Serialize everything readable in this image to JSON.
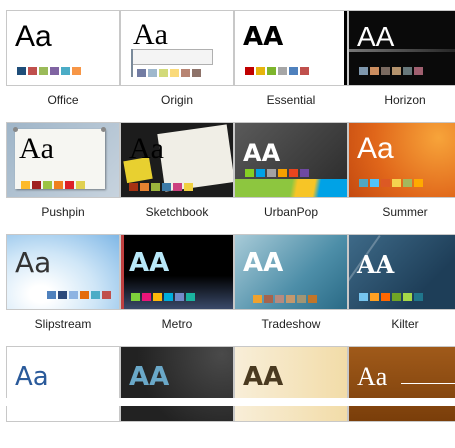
{
  "themes": [
    {
      "name": "Office",
      "aa": "Aa",
      "swatches": [
        "#1f4e79",
        "#c0504d",
        "#9bbb59",
        "#8064a2",
        "#4bacc6",
        "#f79646"
      ]
    },
    {
      "name": "Origin",
      "aa": "Aa",
      "swatches": [
        "#727ca3",
        "#9fb8cd",
        "#d2da7a",
        "#fada7a",
        "#b88472",
        "#8e736a"
      ]
    },
    {
      "name": "Essential",
      "aa": "AA",
      "swatches": [
        "#c00000",
        "#e6b40c",
        "#7db52c",
        "#a6a6a6",
        "#4f81bd",
        "#c0504d"
      ]
    },
    {
      "name": "Horizon",
      "aa": "AA",
      "swatches": [
        "#7e97ad",
        "#cc8e60",
        "#7a6a60",
        "#b4936d",
        "#67787b",
        "#a06070"
      ]
    },
    {
      "name": "Pushpin",
      "aa": "Aa",
      "swatches": [
        "#fdba2c",
        "#a02020",
        "#9cc442",
        "#f08020",
        "#dc2028",
        "#e0d050"
      ]
    },
    {
      "name": "Sketchbook",
      "aa": "Aa",
      "swatches": [
        "#a63212",
        "#e68230",
        "#9bb43c",
        "#3c7aa8",
        "#cc4080",
        "#f0d040"
      ]
    },
    {
      "name": "UrbanPop",
      "aa": "AA",
      "swatches": [
        "#86ce24",
        "#00a2e6",
        "#a3a3a3",
        "#f6a000",
        "#e8451e",
        "#6e49a2"
      ]
    },
    {
      "name": "Summer",
      "aa": "Aa",
      "swatches": [
        "#51a6c2",
        "#51c3f9",
        "#dc5924",
        "#f4d44f",
        "#a3b85d",
        "#ffaa00"
      ]
    },
    {
      "name": "Slipstream",
      "aa": "Aa",
      "swatches": [
        "#4f81bd",
        "#2c4a7c",
        "#8db3e2",
        "#e46c0a",
        "#4bacc6",
        "#c0504d"
      ]
    },
    {
      "name": "Metro",
      "aa": "AA",
      "swatches": [
        "#7fd13b",
        "#ea157a",
        "#feb80a",
        "#00addc",
        "#738ac8",
        "#1ab39f"
      ]
    },
    {
      "name": "Tradeshow",
      "aa": "AA",
      "swatches": [
        "#f0a22e",
        "#a5644e",
        "#b58b80",
        "#c3986d",
        "#a19574",
        "#c17529"
      ]
    },
    {
      "name": "Kilter",
      "aa": "AA",
      "swatches": [
        "#76c5ef",
        "#fea022",
        "#ff6700",
        "#70a525",
        "#a5d848",
        "#20768c"
      ]
    },
    {
      "name": "",
      "aa": "Aa",
      "swatches": []
    },
    {
      "name": "",
      "aa": "AA",
      "swatches": []
    },
    {
      "name": "",
      "aa": "AA",
      "swatches": []
    },
    {
      "name": "",
      "aa": "Aa",
      "swatches": []
    }
  ]
}
